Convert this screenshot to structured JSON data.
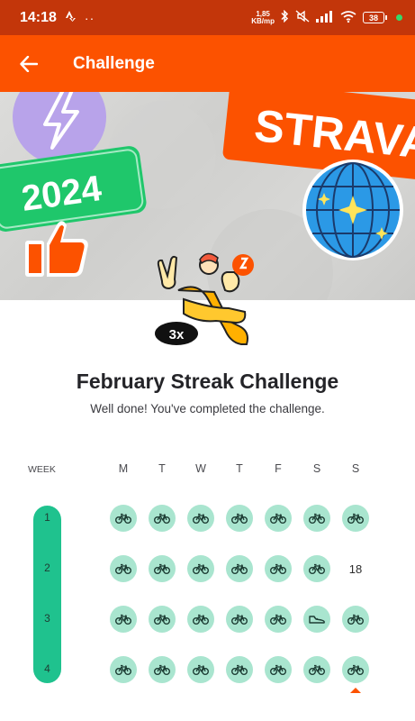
{
  "status_bar": {
    "time": "14:18",
    "net_speed_top": "1,85",
    "net_speed_bottom": "KB/mp",
    "battery": "38"
  },
  "app_bar": {
    "title": "Challenge"
  },
  "banner": {
    "strava_text": "STRAVA",
    "year_text": "2024"
  },
  "badge": {
    "multiplier": "3x"
  },
  "challenge": {
    "title": "February Streak Challenge",
    "subtitle": "Well done! You've completed the challenge."
  },
  "calendar": {
    "week_label": "WEEK",
    "day_headers": [
      "M",
      "T",
      "W",
      "T",
      "F",
      "S",
      "S"
    ],
    "weeks": [
      {
        "label": "1",
        "days": [
          "ride",
          "ride",
          "ride",
          "ride",
          "ride",
          "ride",
          "ride"
        ]
      },
      {
        "label": "2",
        "days": [
          "ride",
          "ride",
          "ride",
          "ride",
          "ride",
          "ride",
          "18"
        ]
      },
      {
        "label": "3",
        "days": [
          "ride",
          "ride",
          "ride",
          "ride",
          "ride",
          "run",
          "ride"
        ]
      },
      {
        "label": "4",
        "days": [
          "ride",
          "ride",
          "ride",
          "ride",
          "ride",
          "ride",
          "ride"
        ]
      }
    ]
  },
  "colors": {
    "brand": "#fc5200",
    "status_bar": "#c3360a",
    "activity_fill": "#a9e5cf",
    "week_pill": "#1fc28e"
  },
  "icons": {
    "ride": "bike-icon",
    "run": "shoe-icon"
  }
}
